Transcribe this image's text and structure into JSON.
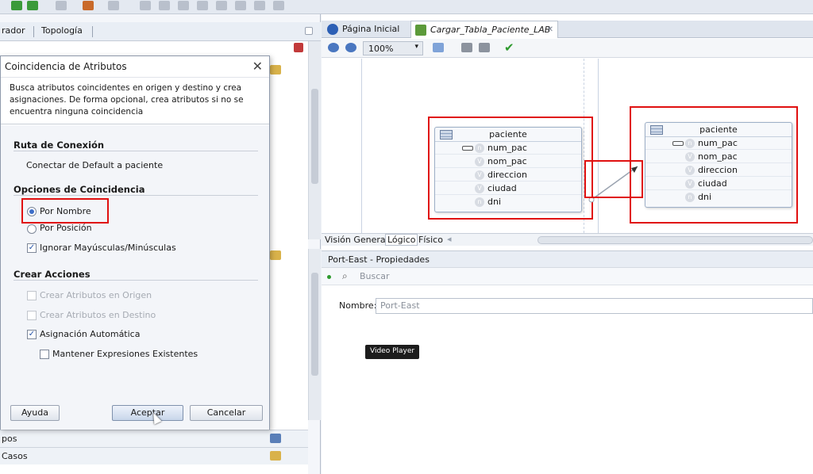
{
  "left_panel": {
    "tabs": [
      "rador",
      "Topología"
    ],
    "sections": [
      "pos",
      "Casos"
    ]
  },
  "dialog": {
    "title": "Coincidencia de Atributos",
    "description": "Busca atributos coincidentes en origen y destino y crea asignaciones. De forma opcional, crea atributos si no se encuentra ninguna coincidencia",
    "ruta": {
      "heading": "Ruta de Conexión",
      "value": "Conectar de Default a paciente"
    },
    "opciones": {
      "heading": "Opciones de Coincidencia",
      "por_nombre": "Por Nombre",
      "por_posicion": "Por Posición",
      "ignorar": "Ignorar Mayúsculas/Minúsculas"
    },
    "crear": {
      "heading": "Crear Acciones",
      "origen": "Crear Atributos en Origen",
      "destino": "Crear Atributos en Destino",
      "asignacion": "Asignación Automática",
      "mantener": "Mantener Expresiones Existentes"
    },
    "buttons": {
      "ayuda": "Ayuda",
      "aceptar": "Aceptar",
      "cancelar": "Cancelar"
    }
  },
  "editor": {
    "tabs": [
      "Página Inicial",
      "Cargar_Tabla_Paciente_LAB"
    ],
    "zoom": "100%",
    "source_entity": {
      "name": "paciente",
      "attributes": [
        "num_pac",
        "nom_pac",
        "direccion",
        "ciudad",
        "dni"
      ]
    },
    "target_entity": {
      "name": "paciente",
      "attributes": [
        "num_pac",
        "nom_pac",
        "direccion",
        "ciudad",
        "dni"
      ]
    },
    "view_tabs": [
      "Visión General",
      "Lógico",
      "Físico"
    ]
  },
  "properties": {
    "title": "Port-East - Propiedades",
    "search_placeholder": "Buscar",
    "name_label": "Nombre:",
    "name_value": "Port-East",
    "tooltip": "Video Player"
  },
  "colors": {
    "highlight": "#e01010",
    "accent": "#3d6ec8"
  }
}
